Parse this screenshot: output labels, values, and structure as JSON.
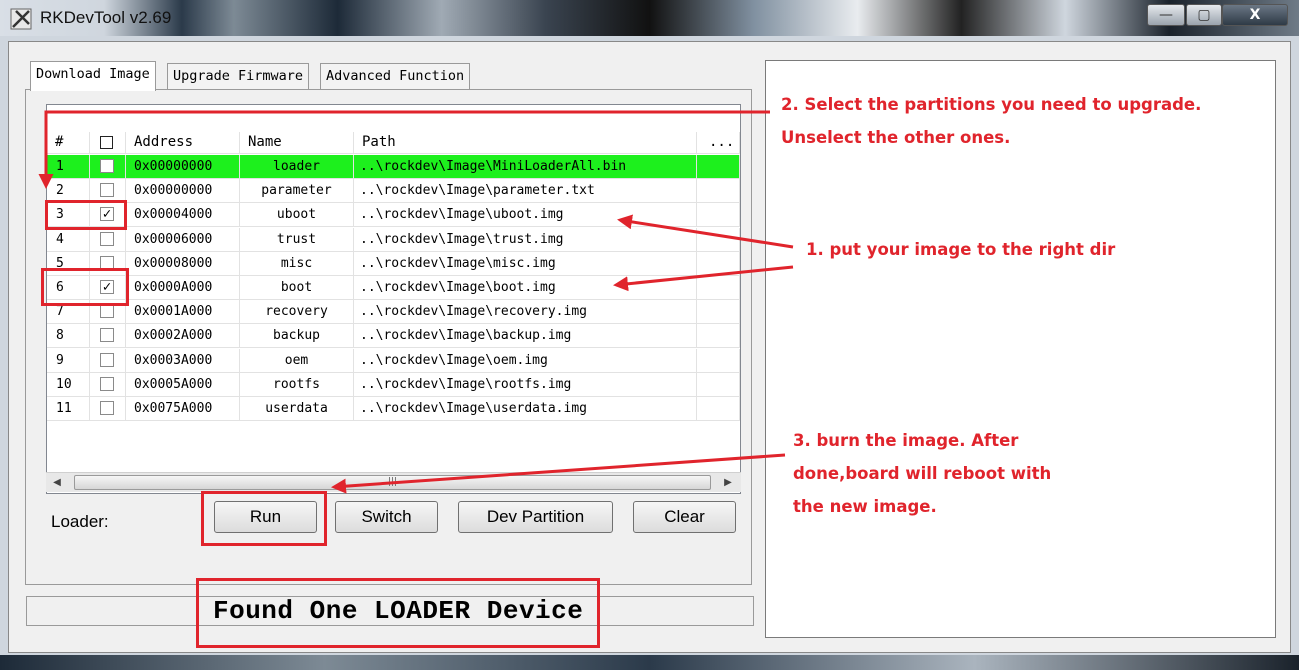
{
  "window": {
    "title": "RKDevTool v2.69",
    "controls": {
      "minimize": "—",
      "maximize": "▢",
      "close": "X"
    }
  },
  "tabs": [
    {
      "label": "Download Image",
      "active": true
    },
    {
      "label": "Upgrade Firmware",
      "active": false
    },
    {
      "label": "Advanced Function",
      "active": false
    }
  ],
  "table": {
    "columns": [
      "#",
      "",
      "Address",
      "Name",
      "Path",
      "..."
    ],
    "rows": [
      {
        "num": "1",
        "checked": false,
        "address": "0x00000000",
        "name": "loader",
        "path": "..\\rockdev\\Image\\MiniLoaderAll.bin",
        "highlight": true
      },
      {
        "num": "2",
        "checked": false,
        "address": "0x00000000",
        "name": "parameter",
        "path": "..\\rockdev\\Image\\parameter.txt",
        "highlight": false
      },
      {
        "num": "3",
        "checked": true,
        "address": "0x00004000",
        "name": "uboot",
        "path": "..\\rockdev\\Image\\uboot.img",
        "highlight": false
      },
      {
        "num": "4",
        "checked": false,
        "address": "0x00006000",
        "name": "trust",
        "path": "..\\rockdev\\Image\\trust.img",
        "highlight": false
      },
      {
        "num": "5",
        "checked": false,
        "address": "0x00008000",
        "name": "misc",
        "path": "..\\rockdev\\Image\\misc.img",
        "highlight": false
      },
      {
        "num": "6",
        "checked": true,
        "address": "0x0000A000",
        "name": "boot",
        "path": "..\\rockdev\\Image\\boot.img",
        "highlight": false
      },
      {
        "num": "7",
        "checked": false,
        "address": "0x0001A000",
        "name": "recovery",
        "path": "..\\rockdev\\Image\\recovery.img",
        "highlight": false
      },
      {
        "num": "8",
        "checked": false,
        "address": "0x0002A000",
        "name": "backup",
        "path": "..\\rockdev\\Image\\backup.img",
        "highlight": false
      },
      {
        "num": "9",
        "checked": false,
        "address": "0x0003A000",
        "name": "oem",
        "path": "..\\rockdev\\Image\\oem.img",
        "highlight": false
      },
      {
        "num": "10",
        "checked": false,
        "address": "0x0005A000",
        "name": "rootfs",
        "path": "..\\rockdev\\Image\\rootfs.img",
        "highlight": false
      },
      {
        "num": "11",
        "checked": false,
        "address": "0x0075A000",
        "name": "userdata",
        "path": "..\\rockdev\\Image\\userdata.img",
        "highlight": false
      }
    ],
    "check_mark": "✓"
  },
  "scrollbar": {
    "left_arrow": "◀",
    "right_arrow": "▶",
    "grip": "|||"
  },
  "controls": {
    "loader_label": "Loader:",
    "buttons": {
      "run": "Run",
      "switch": "Switch",
      "dev_partition": "Dev Partition",
      "clear": "Clear"
    }
  },
  "status": {
    "text": "Found One LOADER Device"
  },
  "annotations": {
    "step2_line1": "2. Select the partitions you need to upgrade.",
    "step2_line2": "Unselect the other ones.",
    "step1": "1. put your image to the right dir",
    "step3_line1": "3. burn the image. After",
    "step3_line2": "done,board will reboot with",
    "step3_line3": "the new image.",
    "color": "#e0242c"
  },
  "colors": {
    "highlight_row": "#1df01d",
    "panel_bg": "#f0f0f0"
  }
}
